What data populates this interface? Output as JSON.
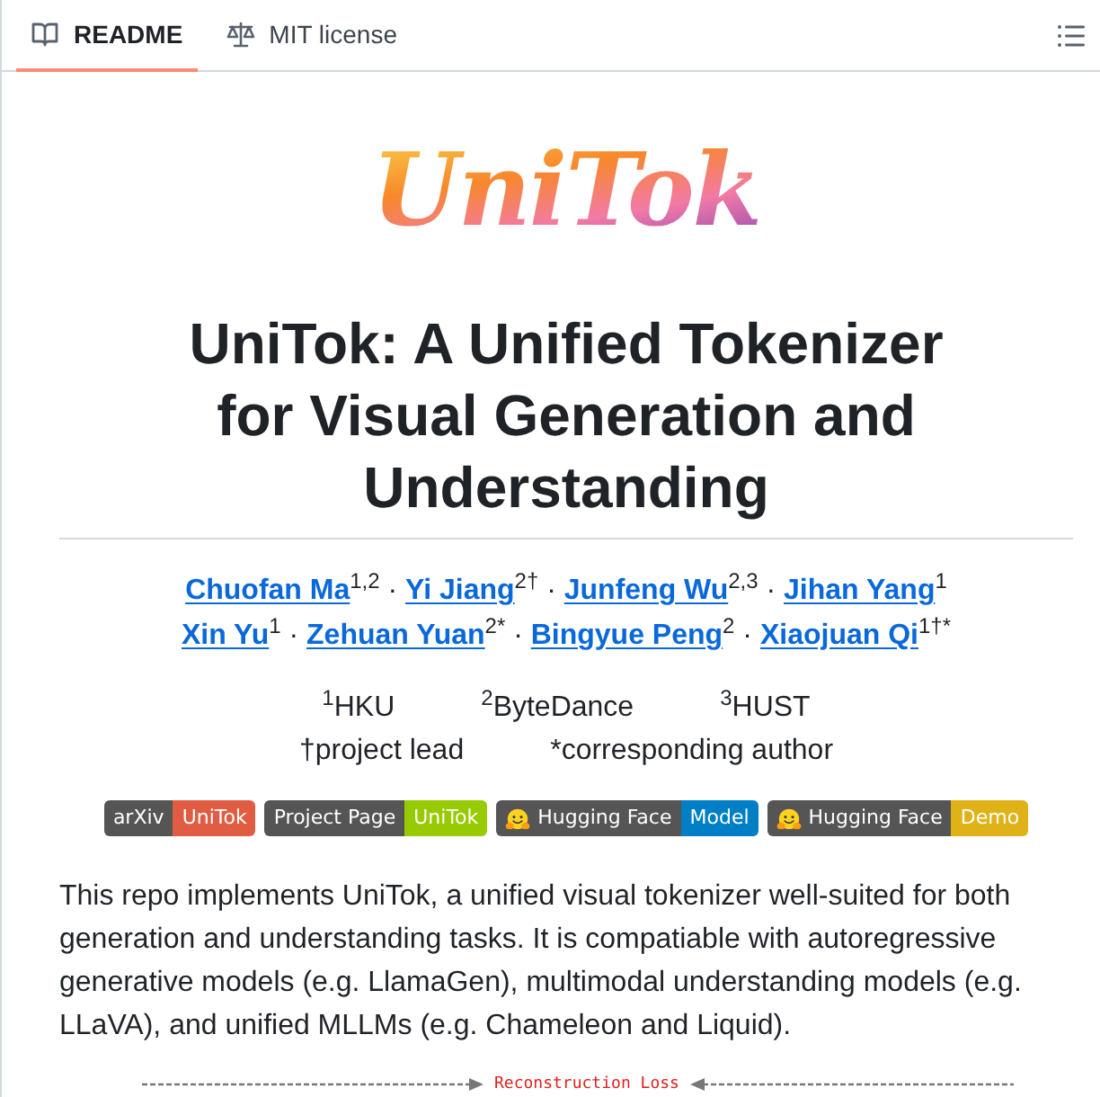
{
  "tabs": [
    {
      "label": "README",
      "kind": "readme",
      "selected": true
    },
    {
      "label": "MIT license",
      "kind": "license",
      "selected": false
    }
  ],
  "logo": {
    "text": "UniTok"
  },
  "title": "UniTok: A Unified Tokenizer for Visual Generation and Understanding",
  "authors": {
    "separator": "·",
    "lines": [
      [
        {
          "name": "Chuofan Ma",
          "marks": "1,2"
        },
        {
          "name": "Yi Jiang",
          "marks": "2†"
        },
        {
          "name": "Junfeng Wu",
          "marks": "2,3"
        },
        {
          "name": "Jihan Yang",
          "marks": "1"
        }
      ],
      [
        {
          "name": "Xin Yu",
          "marks": "1"
        },
        {
          "name": "Zehuan Yuan",
          "marks": "2*"
        },
        {
          "name": "Bingyue Peng",
          "marks": "2"
        },
        {
          "name": "Xiaojuan Qi",
          "marks": "1†*"
        }
      ]
    ]
  },
  "affiliations": [
    "$^{1}$HKU",
    "$^{2}$ByteDance",
    "$^{3}$HUST"
  ],
  "notes": [
    "†project lead",
    "*corresponding author"
  ],
  "badges": [
    {
      "kind": "plain",
      "label": "arXiv",
      "message": "UniTok",
      "color": "#e05d44"
    },
    {
      "kind": "plain",
      "label": "Project Page",
      "message": "UniTok",
      "color": "#97ca00"
    },
    {
      "kind": "emoji",
      "label": "Hugging Face",
      "message": "Model",
      "color": "#007ec6"
    },
    {
      "kind": "emoji",
      "label": "Hugging Face",
      "message": "Demo",
      "color": "#dfb317"
    }
  ],
  "description": "This repo implements UniTok, a unified visual tokenizer well-suited for both generation and understanding tasks. It is compatiable with autoregressive generative models (e.g. LlamaGen), multimodal understanding models (e.g. LLaVA), and unified MLLMs (e.g. Chameleon and Liquid).",
  "figure": {
    "label": "Reconstruction Loss"
  }
}
